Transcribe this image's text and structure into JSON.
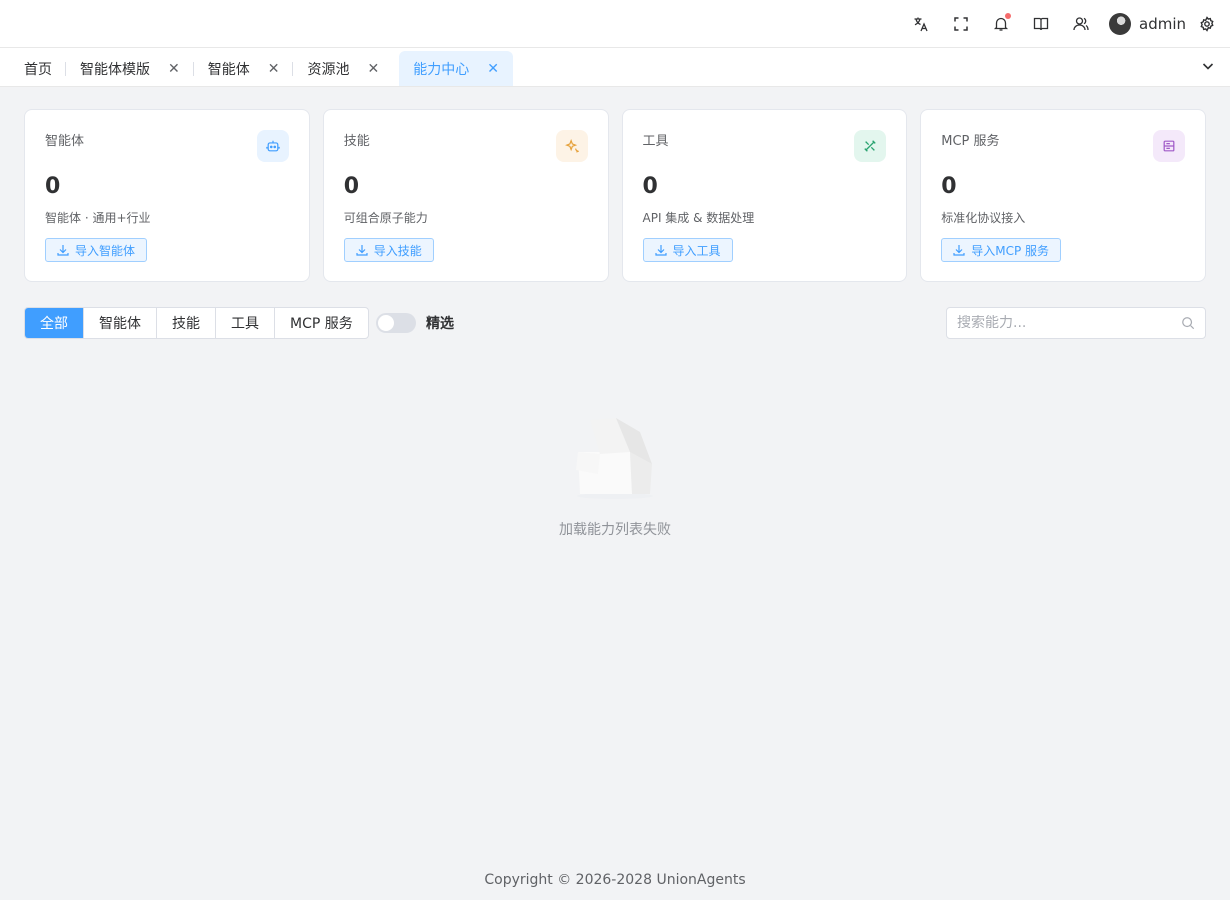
{
  "header": {
    "username": "admin",
    "icons": [
      "translate-icon",
      "fullscreen-icon",
      "bell-icon",
      "book-icon",
      "users-icon",
      "settings-icon"
    ],
    "notification_dot_color": "#f56c6c"
  },
  "tabs": [
    {
      "label": "首页",
      "closable": false
    },
    {
      "label": "智能体模版",
      "closable": true
    },
    {
      "label": "智能体",
      "closable": true
    },
    {
      "label": "资源池",
      "closable": true
    },
    {
      "label": "能力中心",
      "closable": true,
      "active": true
    }
  ],
  "cards": [
    {
      "title": "智能体",
      "count": "0",
      "desc": "智能体 · 通用+行业",
      "button": "导入智能体",
      "icon": "robot-icon",
      "accent": "#409eff",
      "icon_bg": "#e8f3ff"
    },
    {
      "title": "技能",
      "count": "0",
      "desc": "可组合原子能力",
      "button": "导入技能",
      "icon": "sparkle-icon",
      "accent": "#e6a23c",
      "icon_bg": "#fdf3e6"
    },
    {
      "title": "工具",
      "count": "0",
      "desc": "API 集成 & 数据处理",
      "button": "导入工具",
      "icon": "tools-icon",
      "accent": "#2ba471",
      "icon_bg": "#e3f6ee"
    },
    {
      "title": "MCP 服务",
      "count": "0",
      "desc": "标准化协议接入",
      "button": "导入MCP 服务",
      "icon": "server-icon",
      "accent": "#a05ac8",
      "icon_bg": "#f4e9fa"
    }
  ],
  "filters": {
    "options": [
      "全部",
      "智能体",
      "技能",
      "工具",
      "MCP 服务"
    ],
    "active": "全部",
    "featured_label": "精选",
    "featured_on": false
  },
  "search": {
    "placeholder": "搜索能力...",
    "value": ""
  },
  "empty": {
    "message": "加载能力列表失败"
  },
  "footer": {
    "text": "Copyright © 2026-2028 UnionAgents"
  },
  "colors": {
    "primary": "#409eff",
    "background": "#f2f3f5"
  }
}
